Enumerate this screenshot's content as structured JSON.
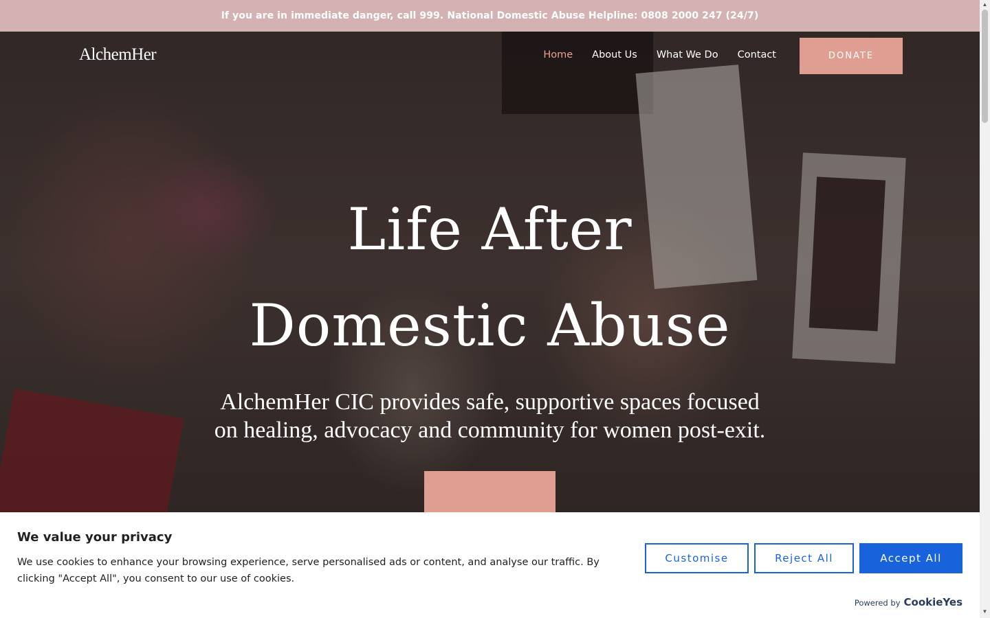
{
  "alert": {
    "text": "If you are in immediate danger, call 999. National Domestic Abuse Helpline: 0808 2000 247 (24/7)"
  },
  "nav": {
    "logo": "AlchemHer",
    "links": [
      {
        "label": "Home",
        "active": true
      },
      {
        "label": "About Us",
        "active": false
      },
      {
        "label": "What We Do",
        "active": false
      },
      {
        "label": "Contact",
        "active": false
      }
    ],
    "donate_label": "DONATE"
  },
  "hero": {
    "title_line1": "Life After",
    "title_line2": "Domestic Abuse",
    "subtitle": "AlchemHer CIC provides safe, supportive spaces focused on healing, advocacy and community for women post-exit."
  },
  "cookie_banner": {
    "title": "We value your privacy",
    "text": "We use cookies to enhance your browsing experience, serve personalised ads or content, and analyse our traffic. By clicking \"Accept All\", you consent to our use of cookies.",
    "customise_label": "Customise",
    "reject_label": "Reject All",
    "accept_label": "Accept All",
    "powered_label": "Powered by",
    "powered_brand": "CookieYes"
  },
  "colors": {
    "alert_bg": "#d4b2b3",
    "accent": "#e09d92",
    "nav_active": "#e7a295",
    "cookie_primary": "#1863dc"
  }
}
